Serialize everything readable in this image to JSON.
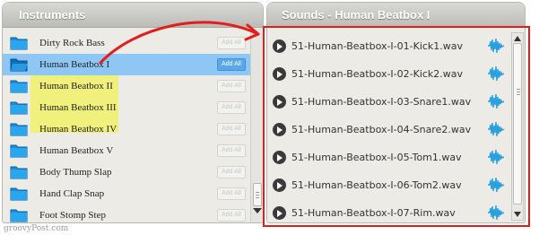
{
  "instruments_panel": {
    "title": "Instruments",
    "items": [
      {
        "name": "Dirty Rock Bass",
        "add_all": "Add All",
        "state": "normal"
      },
      {
        "name": "Human Beatbox I",
        "add_all": "Add All",
        "state": "selected"
      },
      {
        "name": "Human Beatbox II",
        "add_all": "Add All",
        "state": "highlighted"
      },
      {
        "name": "Human Beatbox III",
        "add_all": "Add All",
        "state": "highlighted"
      },
      {
        "name": "Human Beatbox IV",
        "add_all": "Add All",
        "state": "highlighted"
      },
      {
        "name": "Human Beatbox V",
        "add_all": "Add All",
        "state": "highlighted"
      },
      {
        "name": "Body Thump Slap",
        "add_all": "Add All",
        "state": "normal"
      },
      {
        "name": "Hand Clap Snap",
        "add_all": "Add All",
        "state": "normal"
      },
      {
        "name": "Foot Stomp Step",
        "add_all": "Add All",
        "state": "normal"
      }
    ]
  },
  "sounds_panel": {
    "title": "Sounds - Human Beatbox I",
    "items": [
      {
        "file": "51-Human-Beatbox-I-01-Kick1.wav"
      },
      {
        "file": "51-Human-Beatbox-I-02-Kick2.wav"
      },
      {
        "file": "51-Human-Beatbox-I-03-Snare1.wav"
      },
      {
        "file": "51-Human-Beatbox-I-04-Snare2.wav"
      },
      {
        "file": "51-Human-Beatbox-I-05-Tom1.wav"
      },
      {
        "file": "51-Human-Beatbox-I-06-Tom2.wav"
      },
      {
        "file": "51-Human-Beatbox-I-07-Rim.wav"
      }
    ]
  },
  "icons": {
    "folder": "folder-icon",
    "play": "play-icon",
    "waveform": "waveform-icon"
  },
  "colors": {
    "selected_row": "#8ec6f4",
    "highlight": "#f0f07c",
    "annotation": "#e41c1c",
    "folder_blue": "#1a8fd8",
    "waveform_blue": "#2aa0e0"
  },
  "watermark": "groovyPost.com"
}
